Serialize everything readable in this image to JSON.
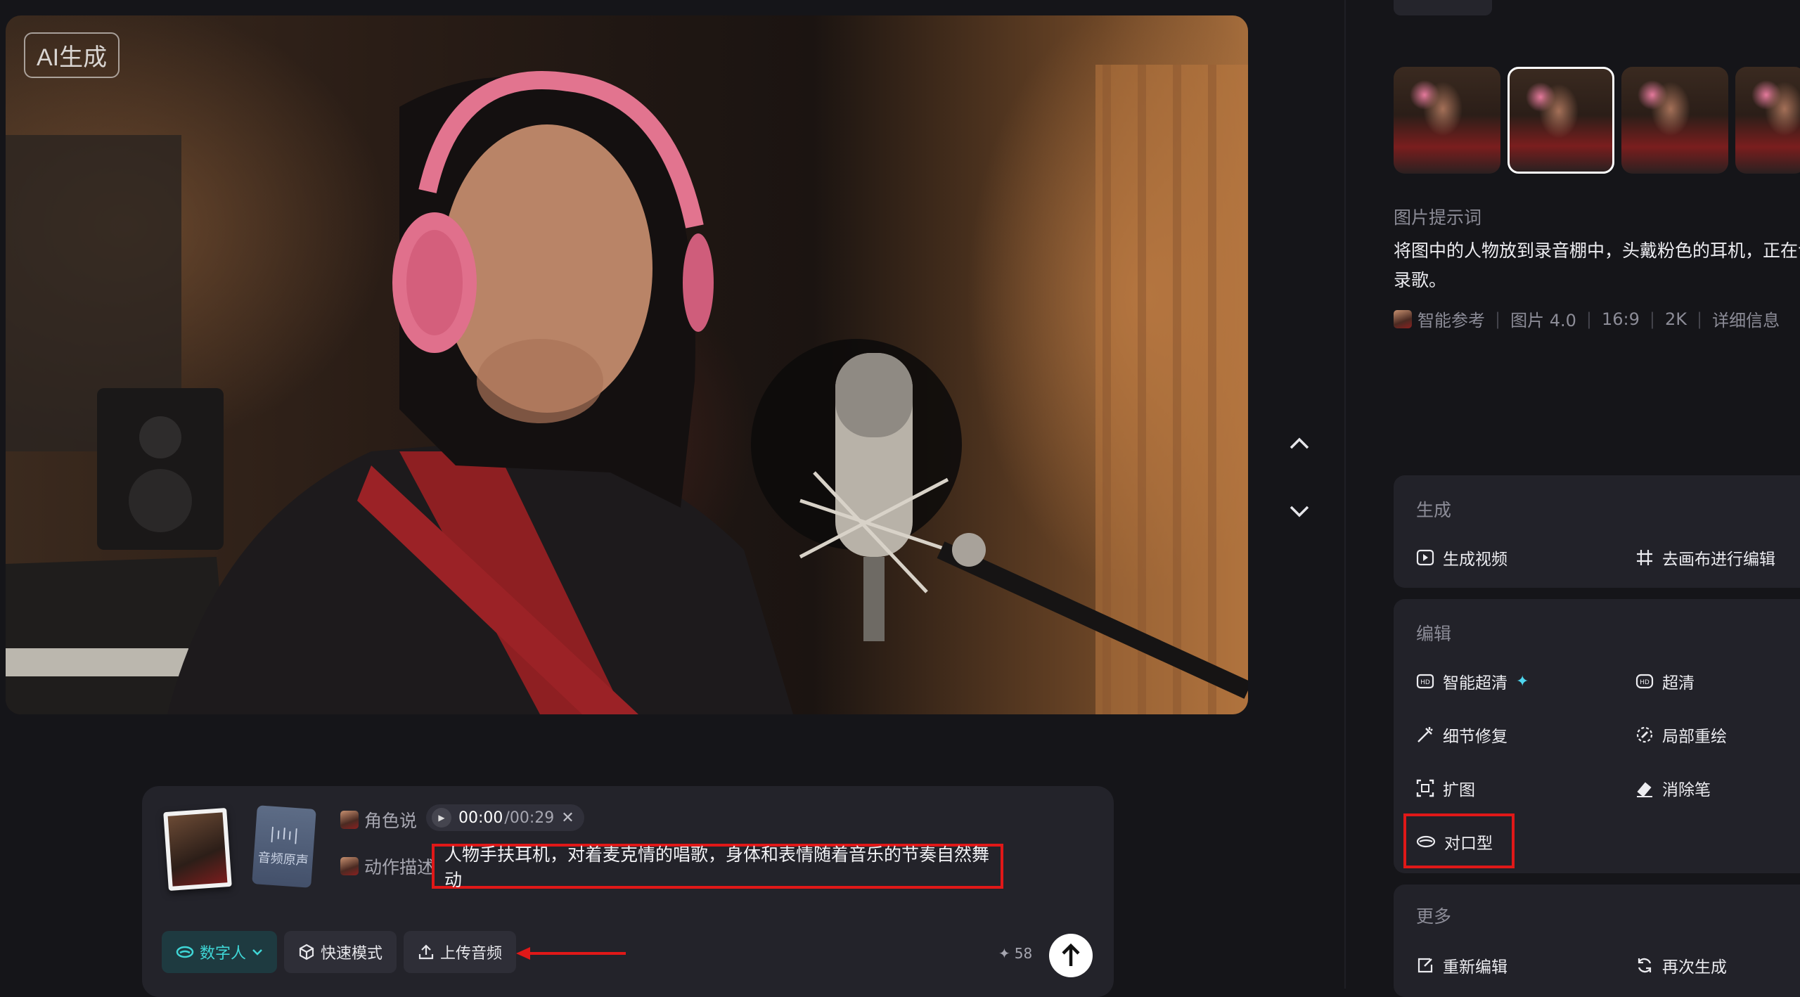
{
  "preview": {
    "badge": "AI生成"
  },
  "composer": {
    "audio_thumb_label": "音频原声",
    "role_label": "角色说",
    "audio_current": "00:00",
    "audio_total": "/00:29",
    "action_label": "动作描述",
    "prompt_text": "人物手扶耳机，对着麦克情的唱歌，身体和表情随着音乐的节奏自然舞动",
    "tools": {
      "digital_human": "数字人",
      "fast_mode": "快速模式",
      "upload_audio": "上传音频"
    },
    "credits": "58"
  },
  "panel": {
    "prompt_heading": "图片提示词",
    "prompt_line1": "将图中的人物放到录音棚中，头戴粉色的耳机，正在专",
    "prompt_line2": "录歌。",
    "meta": {
      "ref": "智能参考",
      "model": "图片 4.0",
      "ratio": "16:9",
      "resolution": "2K",
      "detail": "详细信息"
    },
    "generate": {
      "title": "生成",
      "video": "生成视频",
      "canvas": "去画布进行编辑"
    },
    "edit": {
      "title": "编辑",
      "smart_hd": "智能超清",
      "hd": "超清",
      "detail_fix": "细节修复",
      "inpaint": "局部重绘",
      "expand": "扩图",
      "eraser": "消除笔",
      "lip_sync": "对口型"
    },
    "more": {
      "title": "更多",
      "re_edit": "重新编辑",
      "regenerate": "再次生成"
    }
  },
  "colors": {
    "background": "#151519",
    "card": "#222229",
    "accent_teal": "#3fd6d6",
    "highlight_red": "#e01818"
  }
}
